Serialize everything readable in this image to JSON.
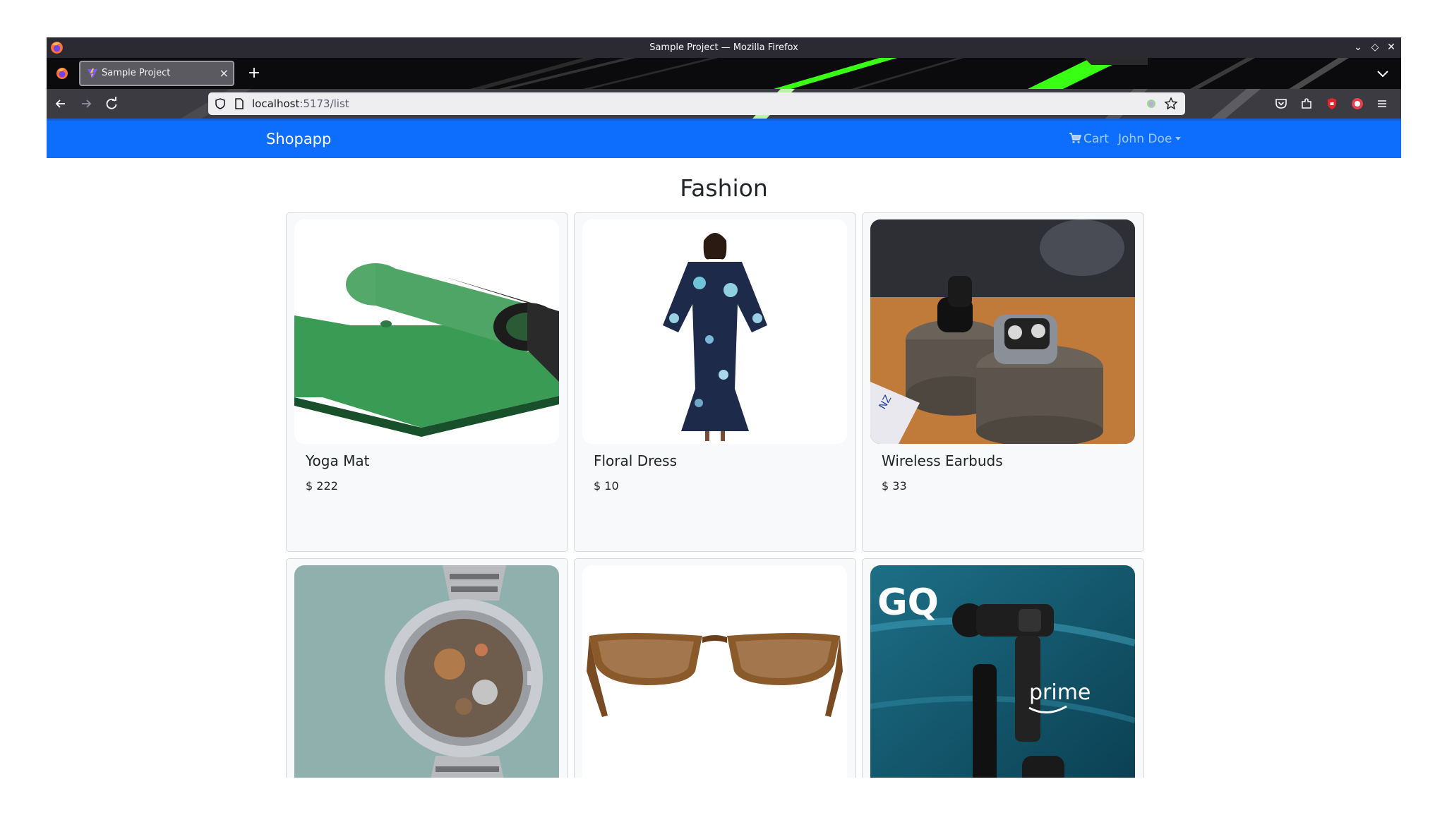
{
  "window": {
    "title": "Sample Project — Mozilla Firefox"
  },
  "tab": {
    "label": "Sample Project"
  },
  "urlbar": {
    "host": "localhost",
    "rest": ":5173/list"
  },
  "app": {
    "brand": "Shopapp",
    "cart": "Cart",
    "user": "John Doe"
  },
  "page": {
    "heading": "Fashion"
  },
  "products": [
    {
      "name": "Yoga Mat",
      "price": "$ 222"
    },
    {
      "name": "Floral Dress",
      "price": "$ 10"
    },
    {
      "name": "Wireless Earbuds",
      "price": "$ 33"
    },
    {
      "name": "",
      "price": ""
    },
    {
      "name": "",
      "price": ""
    },
    {
      "name": "",
      "price": ""
    }
  ],
  "ad_text": {
    "gq": "GQ",
    "prime": "prime"
  },
  "colors": {
    "navbar": "#0d6efd",
    "titlebar": "#2b2a33",
    "accent_green": "#39ff14"
  },
  "icons": [
    "firefox-icon",
    "minimize-icon",
    "maximize-icon",
    "close-icon",
    "back-icon",
    "forward-icon",
    "reload-icon",
    "shield-icon",
    "page-icon",
    "bookmark-star-icon",
    "pocket-icon",
    "extensions-icon",
    "menu-icon",
    "cart-icon"
  ]
}
